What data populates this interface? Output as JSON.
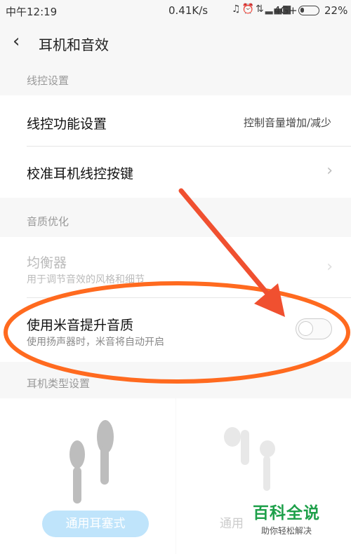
{
  "status_bar": {
    "time": "中午12:19",
    "net_speed": "0.41K/s",
    "network": "4G+",
    "battery_percent": "22%",
    "battery_level": 0.22
  },
  "header": {
    "back_glyph": "‹",
    "title": "耳机和音效"
  },
  "sections": {
    "wire_control": "线控设置",
    "quality": "音质优化",
    "earphone_type": "耳机类型设置"
  },
  "rows": {
    "wire_function": {
      "label": "线控功能设置",
      "value": "控制音量增加/减少"
    },
    "calibrate": {
      "label": "校准耳机线控按键",
      "chevron": "›"
    },
    "equalizer": {
      "label": "均衡器",
      "sub": "用于调节音效的风格和细节",
      "chevron": "›"
    },
    "mi_sound": {
      "label": "使用米音提升音质",
      "sub": "使用扬声器时，米音将自动开启",
      "enabled": false
    }
  },
  "earphone_types": [
    {
      "label": "通用耳塞式"
    },
    {
      "label": "通用"
    }
  ],
  "watermark": {
    "title": "百科全说",
    "subtitle": "助你轻松解决"
  },
  "colors": {
    "annotation": "#ff6a1f",
    "arrow": "#f05030",
    "pill": "#bfe4fb",
    "brand_green": "#1ea04a"
  }
}
